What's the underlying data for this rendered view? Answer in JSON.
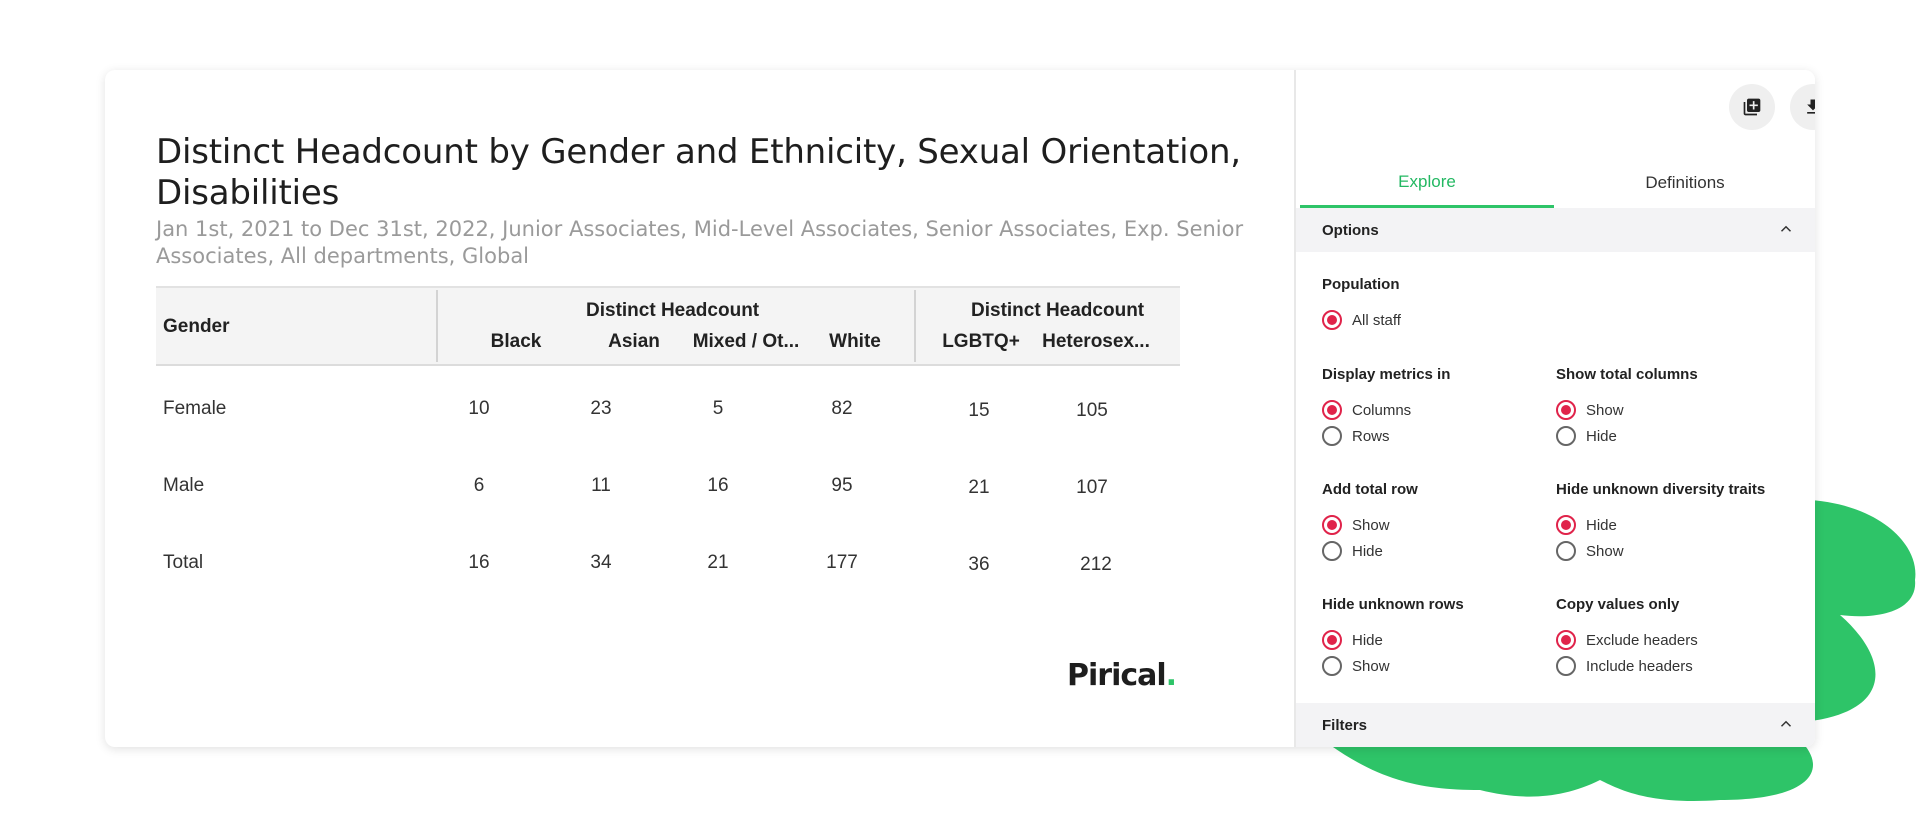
{
  "report": {
    "title": "Distinct Headcount by Gender and Ethnicity, Sexual Orientation, Disabilities",
    "subtitle": "Jan 1st, 2021 to Dec 31st, 2022, Junior Associates, Mid-Level Associates, Senior Associates, Exp. Senior Associates, All departments, Global"
  },
  "table": {
    "row_header": "Gender",
    "groups": [
      {
        "label": "Distinct Headcount",
        "columns": [
          "Black",
          "Asian",
          "Mixed / Ot...",
          "White"
        ]
      },
      {
        "label": "Distinct Headcount",
        "columns": [
          "LGBTQ+",
          "Heterosex..."
        ]
      }
    ],
    "rows": [
      {
        "label": "Female",
        "values": [
          "10",
          "23",
          "5",
          "82",
          "15",
          "105"
        ]
      },
      {
        "label": "Male",
        "values": [
          "6",
          "11",
          "16",
          "95",
          "21",
          "107"
        ]
      },
      {
        "label": "Total",
        "values": [
          "16",
          "34",
          "21",
          "177",
          "36",
          "212"
        ]
      }
    ]
  },
  "brand": {
    "logo_text": "Pirical",
    "logo_dot": ".",
    "accent": "#2ec468"
  },
  "toolbar": {
    "icons": [
      "add-to-collection-icon",
      "download-icon",
      "close-icon"
    ]
  },
  "tabs": {
    "explore": "Explore",
    "definitions": "Definitions"
  },
  "options": {
    "header": "Options",
    "population": {
      "label": "Population",
      "options": [
        "All staff"
      ],
      "selected": "All staff"
    },
    "display_metrics": {
      "label": "Display metrics in",
      "options": [
        "Columns",
        "Rows"
      ],
      "selected": "Columns"
    },
    "show_total_columns": {
      "label": "Show total columns",
      "options": [
        "Show",
        "Hide"
      ],
      "selected": "Show"
    },
    "add_total_row": {
      "label": "Add total row",
      "options": [
        "Show",
        "Hide"
      ],
      "selected": "Show"
    },
    "hide_unknown_traits": {
      "label": "Hide unknown diversity traits",
      "options": [
        "Hide",
        "Show"
      ],
      "selected": "Hide"
    },
    "hide_unknown_rows": {
      "label": "Hide unknown rows",
      "options": [
        "Hide",
        "Show"
      ],
      "selected": "Hide"
    },
    "copy_values_only": {
      "label": "Copy values only",
      "options": [
        "Exclude headers",
        "Include headers"
      ],
      "selected": "Exclude headers"
    }
  },
  "filters": {
    "header": "Filters"
  },
  "colors": {
    "radio_selected": "#e0234a",
    "tab_active": "#23b862",
    "decor_blob": "#2ec468"
  }
}
